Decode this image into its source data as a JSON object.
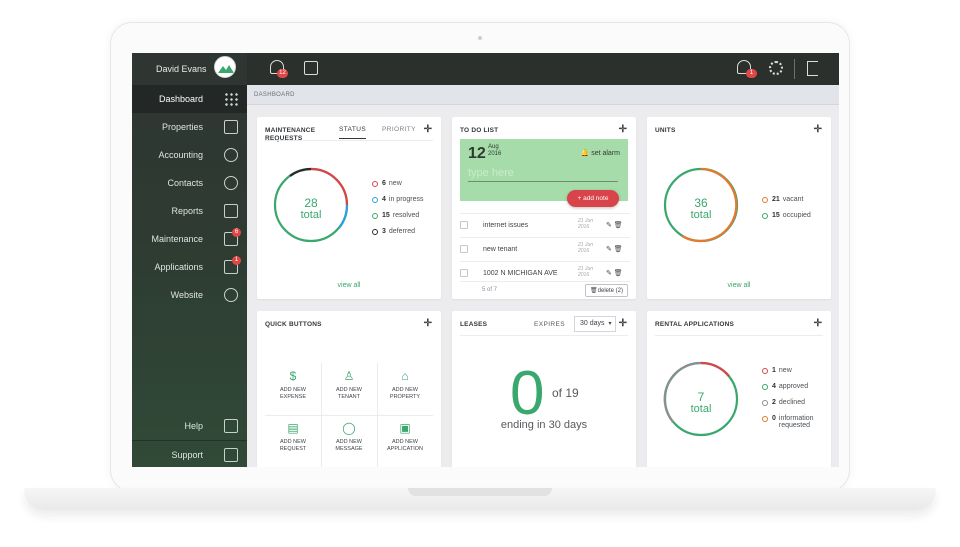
{
  "user": {
    "name": "David Evans"
  },
  "sidebar": {
    "items": [
      {
        "label": "Dashboard",
        "icon": "grid-icon"
      },
      {
        "label": "Properties",
        "icon": "house-icon"
      },
      {
        "label": "Accounting",
        "icon": "money-icon"
      },
      {
        "label": "Contacts",
        "icon": "person-icon"
      },
      {
        "label": "Reports",
        "icon": "bar-chart-icon"
      },
      {
        "label": "Maintenance",
        "icon": "document-icon",
        "badge": "6"
      },
      {
        "label": "Applications",
        "icon": "document-icon",
        "badge": "1"
      },
      {
        "label": "Website",
        "icon": "link-icon"
      }
    ],
    "bottom": [
      {
        "label": "Help",
        "icon": "question-icon"
      },
      {
        "label": "Support",
        "icon": "megaphone-icon"
      }
    ]
  },
  "topbar": {
    "notif_badge": "12",
    "user_notif_badge": "1"
  },
  "breadcrumb": "DASHBOARD",
  "maintenance": {
    "title": "MAINTENANCE REQUESTS",
    "tabs": [
      "STATUS",
      "PRIORITY"
    ],
    "total": "28",
    "total_label": "total",
    "legend": [
      {
        "count": "6",
        "label": "new",
        "color": "#d9444a"
      },
      {
        "count": "4",
        "label": "in progress",
        "color": "#2aa0d8"
      },
      {
        "count": "15",
        "label": "resolved",
        "color": "#3aa76d"
      },
      {
        "count": "3",
        "label": "deferred",
        "color": "#2b2b2b"
      }
    ],
    "view_all": "view all"
  },
  "todo": {
    "title": "TO DO LIST",
    "day": "12",
    "month": "Aug",
    "year": "2016",
    "set_alarm": "set alarm",
    "placeholder": "type here",
    "add_note": "+ add note",
    "items": [
      {
        "text": "internet issues",
        "date_l1": "21 Jun",
        "date_l2": "2016"
      },
      {
        "text": "new tenant",
        "date_l1": "21 Jun",
        "date_l2": "2016"
      },
      {
        "text": "1002 N MICHIGAN AVE",
        "date_l1": "21 Jun",
        "date_l2": "2016"
      }
    ],
    "page_indicator": "5 of 7",
    "delete_label": "delete (2)"
  },
  "units": {
    "title": "UNITS",
    "total": "36",
    "total_label": "total",
    "legend": [
      {
        "count": "21",
        "label": "vacant",
        "color": "#e8782e"
      },
      {
        "count": "15",
        "label": "occupied",
        "color": "#3aa76d"
      }
    ],
    "view_all": "view all"
  },
  "quick_buttons": {
    "title": "QUICK BUTTONS",
    "buttons": [
      {
        "line1": "ADD NEW",
        "line2": "EXPENSE",
        "icon": "dollar-icon"
      },
      {
        "line1": "ADD NEW",
        "line2": "TENANT",
        "icon": "add-person-icon"
      },
      {
        "line1": "ADD NEW",
        "line2": "PROPERTY",
        "icon": "add-house-icon"
      },
      {
        "line1": "ADD NEW",
        "line2": "REQUEST",
        "icon": "request-icon"
      },
      {
        "line1": "ADD NEW",
        "line2": "MESSAGE",
        "icon": "message-icon"
      },
      {
        "line1": "ADD NEW",
        "line2": "APPLICATION",
        "icon": "application-icon"
      }
    ]
  },
  "leases": {
    "title": "LEASES",
    "expires_label": "EXPIRES",
    "days_select": "30 days",
    "count": "0",
    "of_total": "of 19",
    "ending": "ending in 30 days"
  },
  "rental": {
    "title": "RENTAL APPLICATIONS",
    "total": "7",
    "total_label": "total",
    "legend": [
      {
        "count": "1",
        "label": "new",
        "color": "#d9444a"
      },
      {
        "count": "4",
        "label": "approved",
        "color": "#3aa76d"
      },
      {
        "count": "2",
        "label": "declined",
        "color": "#8a8d92"
      },
      {
        "count": "0",
        "label": "information requested",
        "color": "#e8782e"
      }
    ]
  }
}
